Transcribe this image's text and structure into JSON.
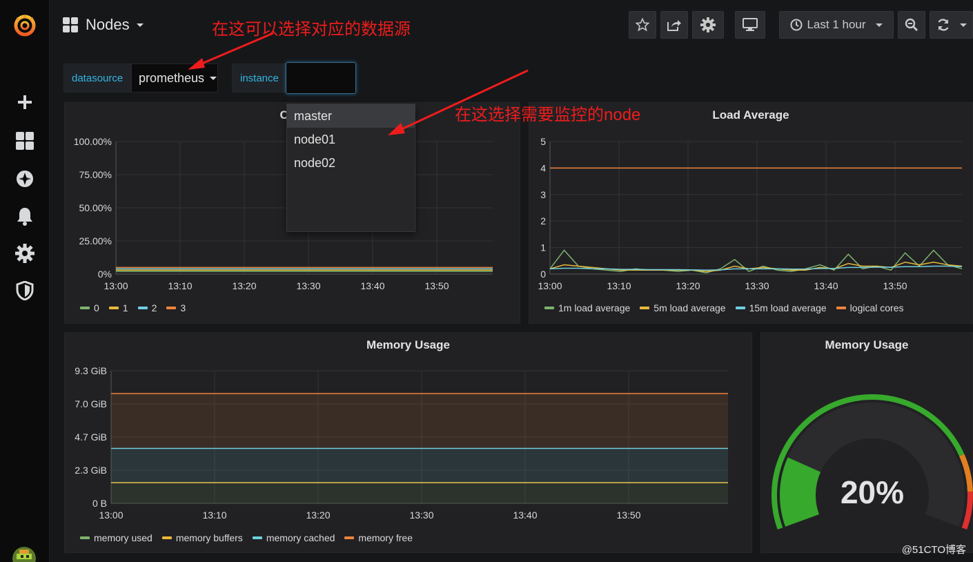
{
  "topnav": {
    "title": "Nodes",
    "time_range": "Last 1 hour"
  },
  "vars": {
    "datasource_label": "datasource",
    "datasource_value": "prometheus",
    "instance_label": "instance"
  },
  "dropdown": {
    "options": [
      "master",
      "node01",
      "node02"
    ]
  },
  "annotations": {
    "datasource_note": "在这可以选择对应的数据源",
    "node_note": "在这选择需要监控的node"
  },
  "panels": {
    "cpu_title": "CPU",
    "load_title": "Load Average",
    "memory_title": "Memory Usage",
    "gauge_title": "Memory Usage",
    "gauge_value": "20%"
  },
  "watermark": "@51CTO博客",
  "colors": {
    "green": "#7eb26d",
    "yellow": "#eab839",
    "cyan": "#6ed0e0",
    "orange": "#ef843c",
    "gauge_green": "#37a92c",
    "gauge_orange": "#e37e21",
    "gauge_red": "#e02f2f",
    "accent_blue": "#33b5e5"
  },
  "chart_data": [
    {
      "type": "line",
      "title": "CPU",
      "x": [
        "13:00",
        "13:10",
        "13:20",
        "13:30",
        "13:40",
        "13:50"
      ],
      "y_ticks": [
        "0%",
        "25.00%",
        "50.00%",
        "75.00%",
        "100.00%"
      ],
      "ylim": [
        0,
        100
      ],
      "series": [
        {
          "name": "0",
          "values": [
            2,
            2,
            2,
            2,
            2,
            2,
            2
          ]
        },
        {
          "name": "1",
          "values": [
            3,
            3,
            3,
            3,
            3,
            3,
            3
          ]
        },
        {
          "name": "2",
          "values": [
            4,
            4,
            4,
            4,
            4,
            4,
            4
          ]
        },
        {
          "name": "3",
          "values": [
            5,
            5,
            5,
            5,
            5,
            5,
            5
          ]
        }
      ]
    },
    {
      "type": "line",
      "title": "Load Average",
      "x": [
        "13:00",
        "13:10",
        "13:20",
        "13:30",
        "13:40",
        "13:50"
      ],
      "y_ticks": [
        "0",
        "1",
        "2",
        "3",
        "4",
        "5"
      ],
      "ylim": [
        0,
        5
      ],
      "series": [
        {
          "name": "1m load average",
          "values": [
            0.2,
            0.9,
            0.3,
            0.2,
            0.15,
            0.1,
            0.2,
            0.15,
            0.15,
            0.1,
            0.15,
            0.05,
            0.2,
            0.55,
            0.1,
            0.3,
            0.15,
            0.1,
            0.2,
            0.35,
            0.15,
            0.75,
            0.2,
            0.3,
            0.15,
            0.8,
            0.3,
            0.9,
            0.35,
            0.2
          ]
        },
        {
          "name": "5m load average",
          "values": [
            0.2,
            0.35,
            0.3,
            0.25,
            0.2,
            0.15,
            0.15,
            0.15,
            0.15,
            0.15,
            0.15,
            0.1,
            0.15,
            0.3,
            0.2,
            0.25,
            0.2,
            0.15,
            0.15,
            0.25,
            0.2,
            0.4,
            0.3,
            0.3,
            0.25,
            0.45,
            0.35,
            0.45,
            0.35,
            0.3
          ]
        },
        {
          "name": "15m load average",
          "values": [
            0.2,
            0.22,
            0.22,
            0.2,
            0.2,
            0.18,
            0.18,
            0.17,
            0.17,
            0.17,
            0.16,
            0.15,
            0.16,
            0.2,
            0.2,
            0.2,
            0.2,
            0.19,
            0.19,
            0.21,
            0.21,
            0.25,
            0.25,
            0.26,
            0.26,
            0.28,
            0.28,
            0.3,
            0.3,
            0.28
          ]
        },
        {
          "name": "logical cores",
          "values": [
            4,
            4,
            4,
            4,
            4,
            4,
            4,
            4,
            4,
            4,
            4,
            4,
            4,
            4,
            4,
            4,
            4,
            4,
            4,
            4,
            4,
            4,
            4,
            4,
            4,
            4,
            4,
            4,
            4,
            4
          ]
        }
      ]
    },
    {
      "type": "area",
      "title": "Memory Usage",
      "x": [
        "13:00",
        "13:10",
        "13:20",
        "13:30",
        "13:40",
        "13:50"
      ],
      "y_ticks": [
        "0 B",
        "2.3 GiB",
        "4.7 GiB",
        "7.0 GiB",
        "9.3 GiB"
      ],
      "ylim": [
        0,
        9.3
      ],
      "series": [
        {
          "name": "memory used",
          "values": [
            1.45,
            1.45,
            1.45,
            1.45,
            1.45,
            1.45
          ]
        },
        {
          "name": "memory buffers",
          "values": [
            1.45,
            1.45,
            1.45,
            1.45,
            1.45,
            1.45
          ]
        },
        {
          "name": "memory cached",
          "values": [
            3.85,
            3.85,
            3.85,
            3.85,
            3.85,
            3.85
          ]
        },
        {
          "name": "memory free",
          "values": [
            7.7,
            7.7,
            7.7,
            7.7,
            7.7,
            7.7
          ]
        }
      ]
    },
    {
      "type": "gauge",
      "title": "Memory Usage",
      "value": 20,
      "min": 0,
      "max": 100
    }
  ]
}
